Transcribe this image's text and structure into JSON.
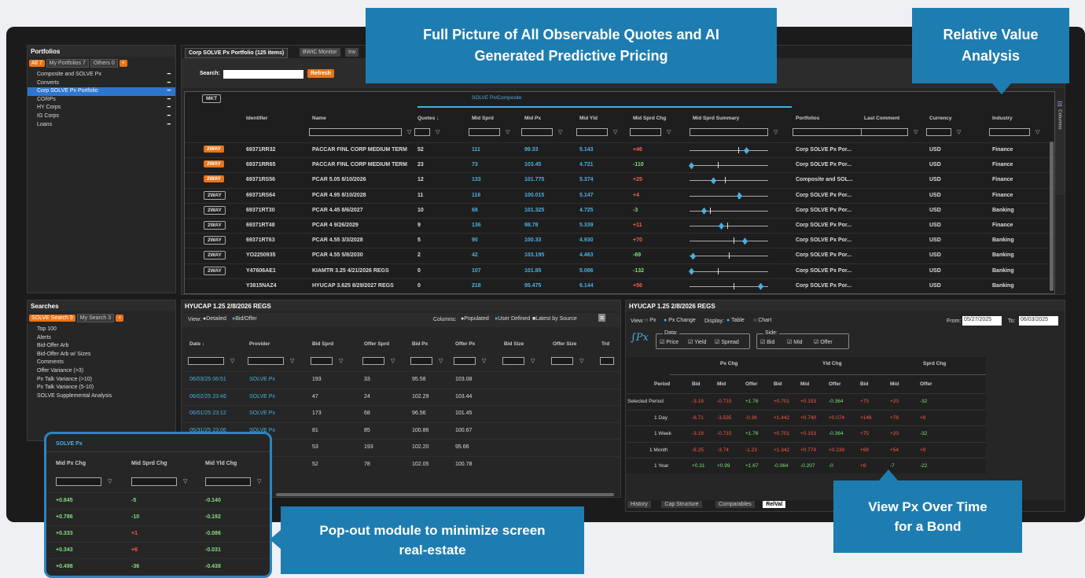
{
  "callouts": {
    "top": "Full Picture of All Observable Quotes and AI Generated Predictive Pricing",
    "relval": "Relative Value Analysis",
    "popout": "Pop-out module to minimize screen real-estate",
    "viewpx": "View Px Over Time for a Bond"
  },
  "portfolios": {
    "title": "Portfolios",
    "chips": [
      "All 7",
      "My Portfolios 7",
      "Others 0"
    ],
    "add": "+",
    "items": [
      "Composite and SOLVE Px",
      "Converts",
      "Corp SOLVE Px Portfolio",
      "CORPs",
      "HY Corps",
      "IG Corps",
      "Loans"
    ],
    "selected": 2
  },
  "searches": {
    "title": "Searches",
    "chips": [
      "SOLVE Search 9",
      "My Search 3"
    ],
    "add": "+",
    "items": [
      "Top 100",
      "Alerts",
      "Bid-Offer Arb",
      "Bid-Offer Arb w/ Sizes",
      "Comments",
      "Offer Variance (>3)",
      "Px Talk Variance (>10)",
      "Px Talk Variance (5-10)",
      "SOLVE Supplemental Analysis"
    ]
  },
  "main": {
    "tabs": [
      "Corp SOLVE Px Portfolio (125 items)",
      "BWIC Monitor",
      "Inv"
    ],
    "search_label": "Search:",
    "refresh": "Refresh",
    "group": "SOLVE Px/Composite",
    "mkt": "MKT",
    "columns_label": "Columns",
    "headers": [
      "Identifier",
      "Name",
      "Quotes ↓",
      "Mid Sprd",
      "Mid Px",
      "Mid Yld",
      "Mid Sprd Chg",
      "Mid Sprd Summary",
      "Portfolios",
      "Last Comment",
      "Currency",
      "Industry"
    ],
    "rows": [
      {
        "tag": "2WAY",
        "or": true,
        "id": "69371RR32",
        "name": "PACCAR FINL CORP MEDIUM TERM",
        "q": "52",
        "sprd": "111",
        "px": "99.33",
        "yld": "5.143",
        "chg": "+46",
        "port": "Corp SOLVE Px Por...",
        "cur": "USD",
        "ind": "Finance",
        "mk": 0.62,
        "dm": 0.72
      },
      {
        "tag": "2WAY",
        "or": true,
        "id": "69371RR65",
        "name": "PACCAR FINL CORP MEDIUM TERM",
        "q": "23",
        "sprd": "73",
        "px": "103.45",
        "yld": "4.721",
        "chg": "-110",
        "port": "Corp SOLVE Px Por...",
        "cur": "USD",
        "ind": "Finance",
        "mk": 0.36,
        "dm": 0.02
      },
      {
        "tag": "2WAY",
        "or": true,
        "id": "69371RS56",
        "name": "PCAR 5.05 8/10/2026",
        "q": "12",
        "sprd": "133",
        "px": "101.775",
        "yld": "5.374",
        "chg": "+25",
        "port": "Composite and SOL...",
        "cur": "USD",
        "ind": "Finance",
        "mk": 0.45,
        "dm": 0.3
      },
      {
        "tag": "2WAY",
        "or": false,
        "id": "69371RS64",
        "name": "PCAR 4.95 8/10/2028",
        "q": "11",
        "sprd": "116",
        "px": "100.015",
        "yld": "5.147",
        "chg": "+4",
        "port": "Corp SOLVE Px Por...",
        "cur": "USD",
        "ind": "Finance",
        "mk": 0.62,
        "dm": 0.63
      },
      {
        "tag": "2WAY",
        "or": false,
        "id": "69371RT30",
        "name": "PCAR 4.45 8/6/2027",
        "q": "10",
        "sprd": "68",
        "px": "101.325",
        "yld": "4.725",
        "chg": "-3",
        "port": "Corp SOLVE Px Por...",
        "cur": "USD",
        "ind": "Banking",
        "mk": 0.26,
        "dm": 0.18
      },
      {
        "tag": "2WAY",
        "or": false,
        "id": "69371RT48",
        "name": "PCAR 4 9/26/2029",
        "q": "9",
        "sprd": "136",
        "px": "98.78",
        "yld": "5.339",
        "chg": "+11",
        "port": "Corp SOLVE Px Por...",
        "cur": "USD",
        "ind": "Finance",
        "mk": 0.48,
        "dm": 0.4
      },
      {
        "tag": "2WAY",
        "or": false,
        "id": "69371RT63",
        "name": "PCAR 4.55 3/3/2028",
        "q": "5",
        "sprd": "90",
        "px": "100.33",
        "yld": "4.930",
        "chg": "+70",
        "port": "Corp SOLVE Px Por...",
        "cur": "USD",
        "ind": "Banking",
        "mk": 0.56,
        "dm": 0.7
      },
      {
        "tag": "2WAY",
        "or": false,
        "id": "YO2250935",
        "name": "PCAR 4.55 5/8/2030",
        "q": "2",
        "sprd": "42",
        "px": "103.195",
        "yld": "4.463",
        "chg": "-69",
        "port": "Corp SOLVE Px Por...",
        "cur": "USD",
        "ind": "Banking",
        "mk": 0.5,
        "dm": 0.04
      },
      {
        "tag": "2WAY",
        "or": false,
        "id": "Y47606AE1",
        "name": "KIAMTR 3.25 4/21/2026 REGS",
        "q": "0",
        "sprd": "107",
        "px": "101.85",
        "yld": "5.086",
        "chg": "-132",
        "port": "Corp SOLVE Px Por...",
        "cur": "USD",
        "ind": "Banking",
        "mk": 0.36,
        "dm": 0.02
      },
      {
        "tag": "",
        "or": false,
        "id": "Y3815NAZ4",
        "name": "HYUCAP 3.625 8/29/2027 REGS",
        "q": "0",
        "sprd": "218",
        "px": "95.475",
        "yld": "6.144",
        "chg": "+56",
        "port": "Corp SOLVE Px Por...",
        "cur": "USD",
        "ind": "Banking",
        "mk": 0.56,
        "dm": 0.9
      }
    ]
  },
  "detail": {
    "title": "HYUCAP 1.25 2/8/2026 REGS",
    "view_label": "View:",
    "view_opts": [
      "Detailed",
      "Bid/Offer"
    ],
    "columns_label": "Columns:",
    "col_opts": [
      "Populated",
      "User Defined"
    ],
    "latest": "Latest by Source",
    "headers": [
      "Date ↓",
      "Provider",
      "Bid Sprd",
      "Offer Sprd",
      "Bid Px",
      "Offer Px",
      "Bid Size",
      "Offer Size",
      "Trd"
    ],
    "rows": [
      [
        "06/03/25 06:51",
        "SOLVE Px",
        "193",
        "33",
        "95.58",
        "103.08"
      ],
      [
        "06/02/25 23:46",
        "SOLVE Px",
        "47",
        "24",
        "102.29",
        "103.44"
      ],
      [
        "06/01/25 23:12",
        "SOLVE Px",
        "173",
        "68",
        "96.56",
        "101.45"
      ],
      [
        "05/31/25 23:06",
        "SOLVE Px",
        "81",
        "85",
        "100.86",
        "100.67"
      ],
      [
        "",
        "",
        "53",
        "193",
        "102.20",
        "95.66"
      ],
      [
        "",
        "",
        "52",
        "78",
        "102.05",
        "100.78"
      ]
    ]
  },
  "popout": {
    "title": "SOLVE Px",
    "headers": [
      "Mid Px Chg",
      "Mid Sprd Chg",
      "Mid Yld Chg"
    ],
    "rows": [
      [
        "+0.845",
        "-5",
        "-0.140"
      ],
      [
        "+0.786",
        "-10",
        "-0.192"
      ],
      [
        "+0.333",
        "+1",
        "-0.086"
      ],
      [
        "+0.343",
        "+6",
        "-0.031"
      ],
      [
        "+0.498",
        "-36",
        "-0.438"
      ]
    ]
  },
  "relval": {
    "title": "HYUCAP 1.25 2/8/2026 REGS",
    "view_label": "View:",
    "view_opts": [
      "Px",
      "Px Change"
    ],
    "display_label": "Display:",
    "display_opts": [
      "Table",
      "Chart"
    ],
    "from_label": "From:",
    "from": "05/27/2025",
    "to_label": "To:",
    "to": "06/03/2025",
    "data_label": "Data:",
    "data_opts": [
      "Price",
      "Yield",
      "Spread"
    ],
    "side_label": "Side:",
    "side_opts": [
      "Bid",
      "Mid",
      "Offer"
    ],
    "groups": [
      "Px Chg",
      "Yld Chg",
      "Sprd Chg"
    ],
    "sub": [
      "Period",
      "Bid",
      "Mid",
      "Offer",
      "Bid",
      "Mid",
      "Offer",
      "Bid",
      "Mid",
      "Offer"
    ],
    "rows": [
      [
        "Selected Period",
        "-3.19",
        "-0.715",
        "+1.76",
        "+0.701",
        "+0.153",
        "-0.364",
        "+75",
        "+20",
        "-32"
      ],
      [
        "1 Day",
        "-6.71",
        "-3.535",
        "-0.36",
        "+1.442",
        "+0.740",
        "+0.074",
        "+146",
        "+76",
        "+9"
      ],
      [
        "1 Week",
        "-3.19",
        "-0.715",
        "+1.76",
        "+0.701",
        "+0.153",
        "-0.364",
        "+75",
        "+20",
        "-32"
      ],
      [
        "1 Month",
        "-6.25",
        "-3.74",
        "-1.23",
        "+1.342",
        "+0.774",
        "+0.239",
        "+99",
        "+54",
        "+9"
      ],
      [
        "1 Year",
        "+0.31",
        "+0.99",
        "+1.67",
        "-0.064",
        "-0.207",
        "-0",
        "+8",
        "-7",
        "-22"
      ]
    ],
    "tabs": [
      "History",
      "Cap Structure",
      "Comparables",
      "RelVal"
    ]
  }
}
